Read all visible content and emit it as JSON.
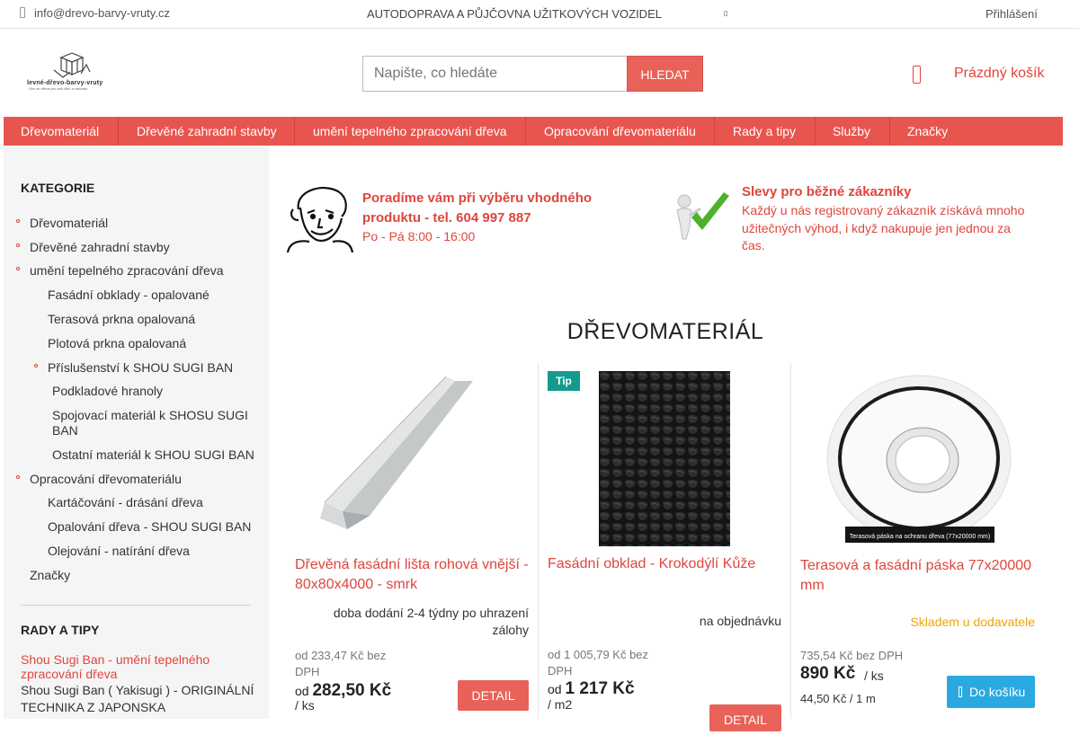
{
  "topbar": {
    "email": "info@drevo-barvy-vruty.cz",
    "center_link": "AUTODOPRAVA A PŮJČOVNA UŽITKOVÝCH VOZIDEL",
    "login": "Přihlášení"
  },
  "logo": {
    "text": "levné-dřevo-barvy-vruty",
    "tagline": "Vše ze dřeva pro váš dům a zahradu"
  },
  "search": {
    "placeholder": "Napište, co hledáte",
    "button": "HLEDAT"
  },
  "cart": {
    "label": "Prázdný košík"
  },
  "nav": {
    "items": [
      "Dřevomateriál",
      "Dřevěné zahradní stavby",
      "umění tepelného zpracování dřeva",
      "Opracování dřevomateriálu",
      "Rady a tipy",
      "Služby",
      "Značky"
    ]
  },
  "sidebar": {
    "categories_title": "KATEGORIE",
    "items": [
      "Dřevomateriál",
      "Dřevěné zahradní stavby",
      "umění tepelného zpracování dřeva",
      "Fasádní obklady - opalované",
      "Terasová prkna opalovaná",
      "Plotová prkna opalovaná",
      "Příslušenství k SHOU SUGI BAN",
      "Podkladové hranoly",
      "Spojovací materiál k SHOSU SUGI BAN",
      "Ostatní materiál k SHOU SUGI BAN",
      "Opracování dřevomateriálu",
      "Kartáčování - drásání dřeva",
      "Opalování dřeva - SHOU SUGI BAN",
      "Olejování - natírání dřeva",
      "Značky"
    ],
    "tips_title": "RADY A TIPY",
    "tip_link": "Shou Sugi Ban - umění tepelného zpracování dřeva",
    "tip_text": "Shou Sugi Ban  ( Yakisugi ) - ORIGINÁLNÍ TECHNIKA Z JAPONSKA"
  },
  "info": {
    "advice_title": "Poradíme vám při výběru vhodného produktu - tel. 604 997 887",
    "advice_hours": "Po - Pá 8:00 - 16:00",
    "discount_title": "Slevy pro běžné zákazníky",
    "discount_text": "Každý u nás registrovaný zákazník získává mnoho užitečných výhod, i když nakupuje jen jednou za čas."
  },
  "heading": "DŘEVOMATERIÁL",
  "products": [
    {
      "name": "Dřevěná fasádní lišta rohová vnější - 80x80x4000 - smrk",
      "availability": "doba dodání 2-4 týdny po uhrazení zálohy",
      "price_ex": "od 233,47 Kč bez DPH",
      "price_prefix": "od",
      "price": "282,50 Kč",
      "unit": "/ ks",
      "button": "DETAIL"
    },
    {
      "badge": "Tip",
      "name": "Fasádní obklad - Krokodýlí Kůže",
      "availability": "na objednávku",
      "price_ex": "od 1 005,79 Kč bez DPH",
      "price_prefix": "od",
      "price": "1 217 Kč",
      "unit": "/ m2",
      "button": "DETAIL"
    },
    {
      "name": "Terasová a fasádní páska 77x20000 mm",
      "availability": "Skladem u dodavatele",
      "price_ex": "735,54 Kč bez DPH",
      "price": "890 Kč",
      "unit": "/ ks",
      "price_per": "44,50 Kč / 1 m",
      "button": "Do košíku",
      "image_caption": "Terasová páska na ochranu dřeva (77x20000 mm)"
    }
  ],
  "colors": {
    "accent": "#e8554e",
    "link": "#e0453c",
    "stock": "#f0a30a",
    "cart_button": "#2aa9e0",
    "tip_badge": "#169a8e"
  }
}
